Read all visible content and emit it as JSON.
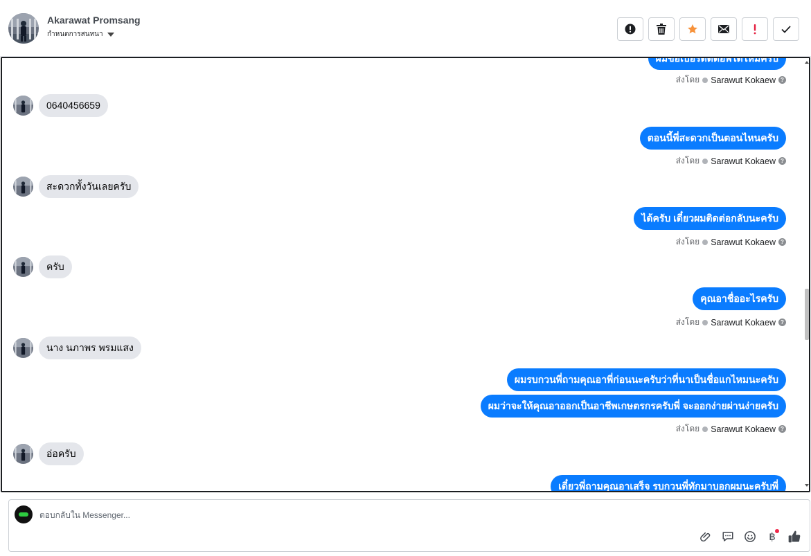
{
  "header": {
    "contact_name": "Akarawat Promsang",
    "assign_label": "กำหนดการสนทนา",
    "toolbar": [
      {
        "name": "spam-button",
        "icon": "alert-circle-icon"
      },
      {
        "name": "delete-button",
        "icon": "trash-icon"
      },
      {
        "name": "star-button",
        "icon": "star-icon",
        "color": "#f7923b"
      },
      {
        "name": "mark-unread-button",
        "icon": "envelope-icon"
      },
      {
        "name": "important-button",
        "icon": "exclamation-icon",
        "color": "#e41e3f"
      },
      {
        "name": "done-button",
        "icon": "checkmark-icon"
      }
    ]
  },
  "messages": [
    {
      "dir": "out",
      "text": "ผมขอเบอร์ติดต่อพี่ได้ไหมครับ"
    },
    {
      "dir": "in",
      "text": "0640456659"
    },
    {
      "dir": "out",
      "text": "ตอนนี้พี่สะดวกเป็นตอนไหนครับ"
    },
    {
      "dir": "in",
      "text": "สะดวกทั้งวันเลยครับ"
    },
    {
      "dir": "out",
      "text": "ได้ครับ เดี๋ยวผมติดต่อกลับนะครับ"
    },
    {
      "dir": "in",
      "text": "ครับ"
    },
    {
      "dir": "out",
      "text": "คุณอาชื่ออะไรครับ"
    },
    {
      "dir": "in",
      "text": "นาง นภาพร พรมแสง"
    },
    {
      "dir": "out",
      "text": "ผมรบกวนพี่ถามคุณอาพี่ก่อนนะครับว่าที่นาเป็นชื่อแกไหมนะครับ"
    },
    {
      "dir": "out",
      "text": "ผมว่าจะให้คุณอาออกเป็นอาชีพเกษตรกรครับพี่ จะออกง่ายผ่านง่ายครับ"
    },
    {
      "dir": "in",
      "text": "อ่อครับ"
    },
    {
      "dir": "out",
      "text": "เดี๋ยวพี่ถามคุณอาเสร็จ รบกวนพี่ทักมาบอกผมนะครับพี่"
    }
  ],
  "sent_by": {
    "prefix": "ส่งโดย",
    "sender": "Sarawut Kokaew",
    "help": "?"
  },
  "composer": {
    "placeholder": "ตอบกลับใน Messenger...",
    "tools": [
      "paperclip-icon",
      "chat-bubble-icon",
      "emoji-icon",
      "baht-icon",
      "thumbs-up-icon"
    ],
    "baht_symbol": "฿"
  },
  "colors": {
    "outgoing_bubble": "#0a7cff",
    "incoming_bubble": "#e4e6eb",
    "notification_dot": "#f02849"
  }
}
